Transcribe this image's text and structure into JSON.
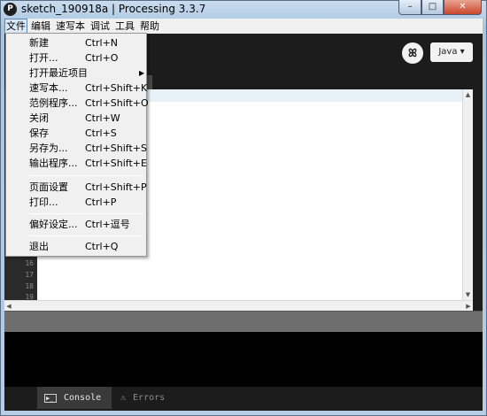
{
  "window": {
    "title": "sketch_190918a | Processing 3.3.7",
    "app_icon_glyph": "P",
    "minimize_glyph": "–",
    "maximize_glyph": "□",
    "close_glyph": "✕"
  },
  "menubar": {
    "items": [
      "文件",
      "编辑",
      "速写本",
      "调试",
      "工具",
      "帮助"
    ]
  },
  "file_menu": {
    "items": [
      {
        "label": "新建",
        "shortcut": "Ctrl+N"
      },
      {
        "label": "打开...",
        "shortcut": "Ctrl+O"
      },
      {
        "label": "打开最近项目",
        "shortcut": "",
        "submenu_arrow": "▶"
      },
      {
        "label": "速写本...",
        "shortcut": "Ctrl+Shift+K"
      },
      {
        "label": "范例程序...",
        "shortcut": "Ctrl+Shift+O"
      },
      {
        "label": "关闭",
        "shortcut": "Ctrl+W"
      },
      {
        "label": "保存",
        "shortcut": "Ctrl+S"
      },
      {
        "label": "另存为...",
        "shortcut": "Ctrl+Shift+S"
      },
      {
        "label": "输出程序...",
        "shortcut": "Ctrl+Shift+E"
      },
      {
        "label": "页面设置",
        "shortcut": "Ctrl+Shift+P"
      },
      {
        "label": "打印...",
        "shortcut": "Ctrl+P"
      },
      {
        "label": "偏好设定...",
        "shortcut": "Ctrl+逗号"
      },
      {
        "label": "退出",
        "shortcut": "Ctrl+Q"
      }
    ]
  },
  "toolbar": {
    "mode_label": "Java ▾",
    "debug_icon": "debugger-butterfly-icon",
    "debug_glyph": "ꕤ"
  },
  "editor": {
    "line_numbers": [
      "16",
      "17",
      "18",
      "19"
    ]
  },
  "scroll": {
    "up": "▲",
    "down": "▼",
    "left": "◀",
    "right": "▶"
  },
  "footer": {
    "console_label": "Console",
    "errors_label": "Errors",
    "console_glyph": "▶_",
    "errors_glyph": "⚠"
  },
  "colors": {
    "editor_dark": "#1c1c1c",
    "current_line": "#e6f2f8",
    "menu_bg": "#f0f0f0"
  }
}
